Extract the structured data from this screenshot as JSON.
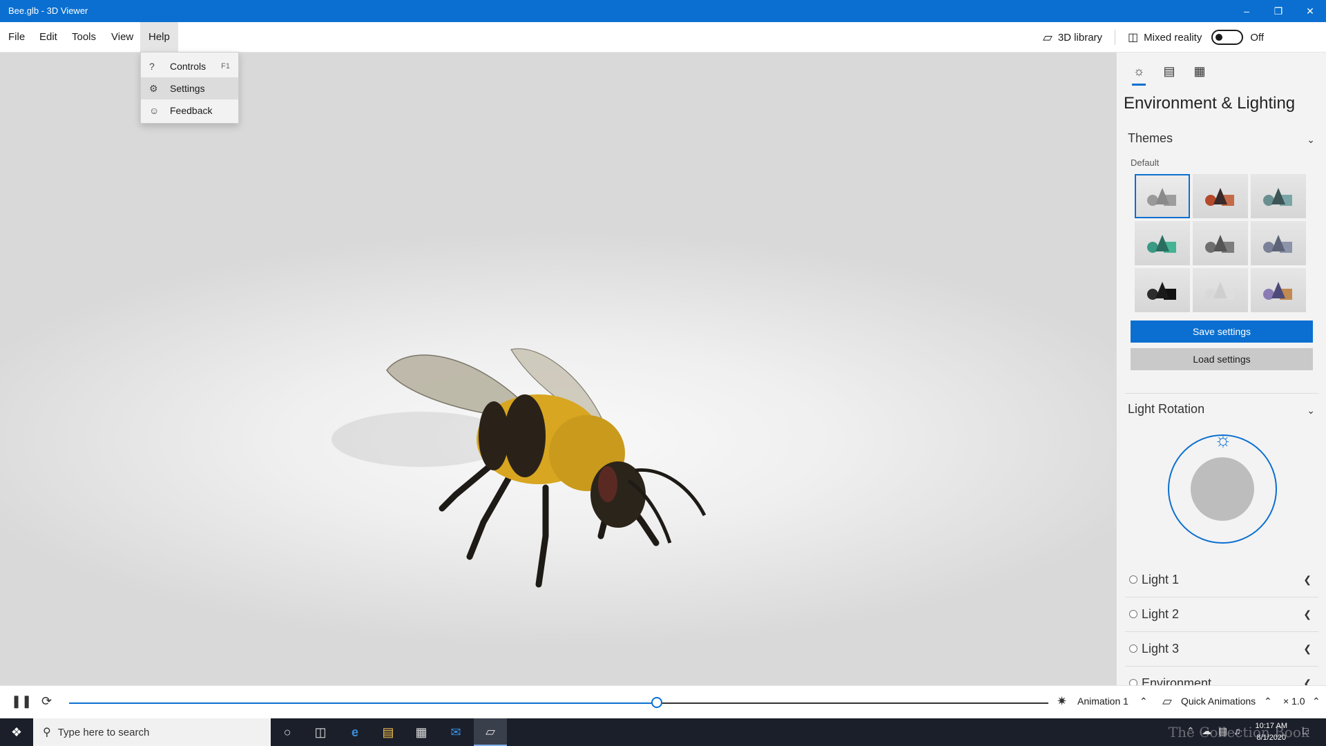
{
  "window": {
    "title": "Bee.glb - 3D Viewer"
  },
  "menu": {
    "items": [
      "File",
      "Edit",
      "Tools",
      "View",
      "Help"
    ],
    "active": "Help"
  },
  "topbar": {
    "library": "3D library",
    "mixed_reality": "Mixed reality",
    "mixed_reality_state": "Off"
  },
  "help_menu": {
    "items": [
      {
        "icon": "question-icon",
        "label": "Controls",
        "shortcut": "F1"
      },
      {
        "icon": "gear-icon",
        "label": "Settings",
        "shortcut": ""
      },
      {
        "icon": "feedback-icon",
        "label": "Feedback",
        "shortcut": ""
      }
    ]
  },
  "panel": {
    "title": "Environment & Lighting",
    "themes": {
      "heading": "Themes",
      "default_label": "Default",
      "tiles": [
        {
          "cone": "#8a8a8a",
          "sphere": "#9a9a9a",
          "box": "#9d9d9d"
        },
        {
          "cone": "#3a2a2a",
          "sphere": "#b4492b",
          "box": "#c56a48"
        },
        {
          "cone": "#3d5557",
          "sphere": "#6a8f90",
          "box": "#7aa5a6"
        },
        {
          "cone": "#2a6e60",
          "sphere": "#3b9a84",
          "box": "#46b394"
        },
        {
          "cone": "#555555",
          "sphere": "#6e6e6e",
          "box": "#7d7d7d"
        },
        {
          "cone": "#5e6478",
          "sphere": "#7b8198",
          "box": "#8d93a8"
        },
        {
          "cone": "#1a1a1a",
          "sphere": "#2d2d2d",
          "box": "#111111"
        },
        {
          "cone": "#cfcfcf",
          "sphere": "#d9d9d9",
          "box": "#dedede"
        },
        {
          "cone": "#4d4a7a",
          "sphere": "#8a7bb4",
          "box": "#c08a52"
        }
      ]
    },
    "save_label": "Save settings",
    "load_label": "Load settings",
    "light_rotation": "Light Rotation",
    "lights": [
      "Light 1",
      "Light 2",
      "Light 3",
      "Environment"
    ]
  },
  "animation": {
    "name": "Animation 1",
    "quick": "Quick Animations",
    "speed": "× 1.0",
    "progress": 0.6
  },
  "taskbar": {
    "search_placeholder": "Type here to search",
    "time": "10:17 AM",
    "date": "8/1/2020"
  },
  "colors": {
    "accent": "#0a6fd0",
    "titlebar": "#0a6fd0",
    "taskbar": "#1b1f2a"
  }
}
